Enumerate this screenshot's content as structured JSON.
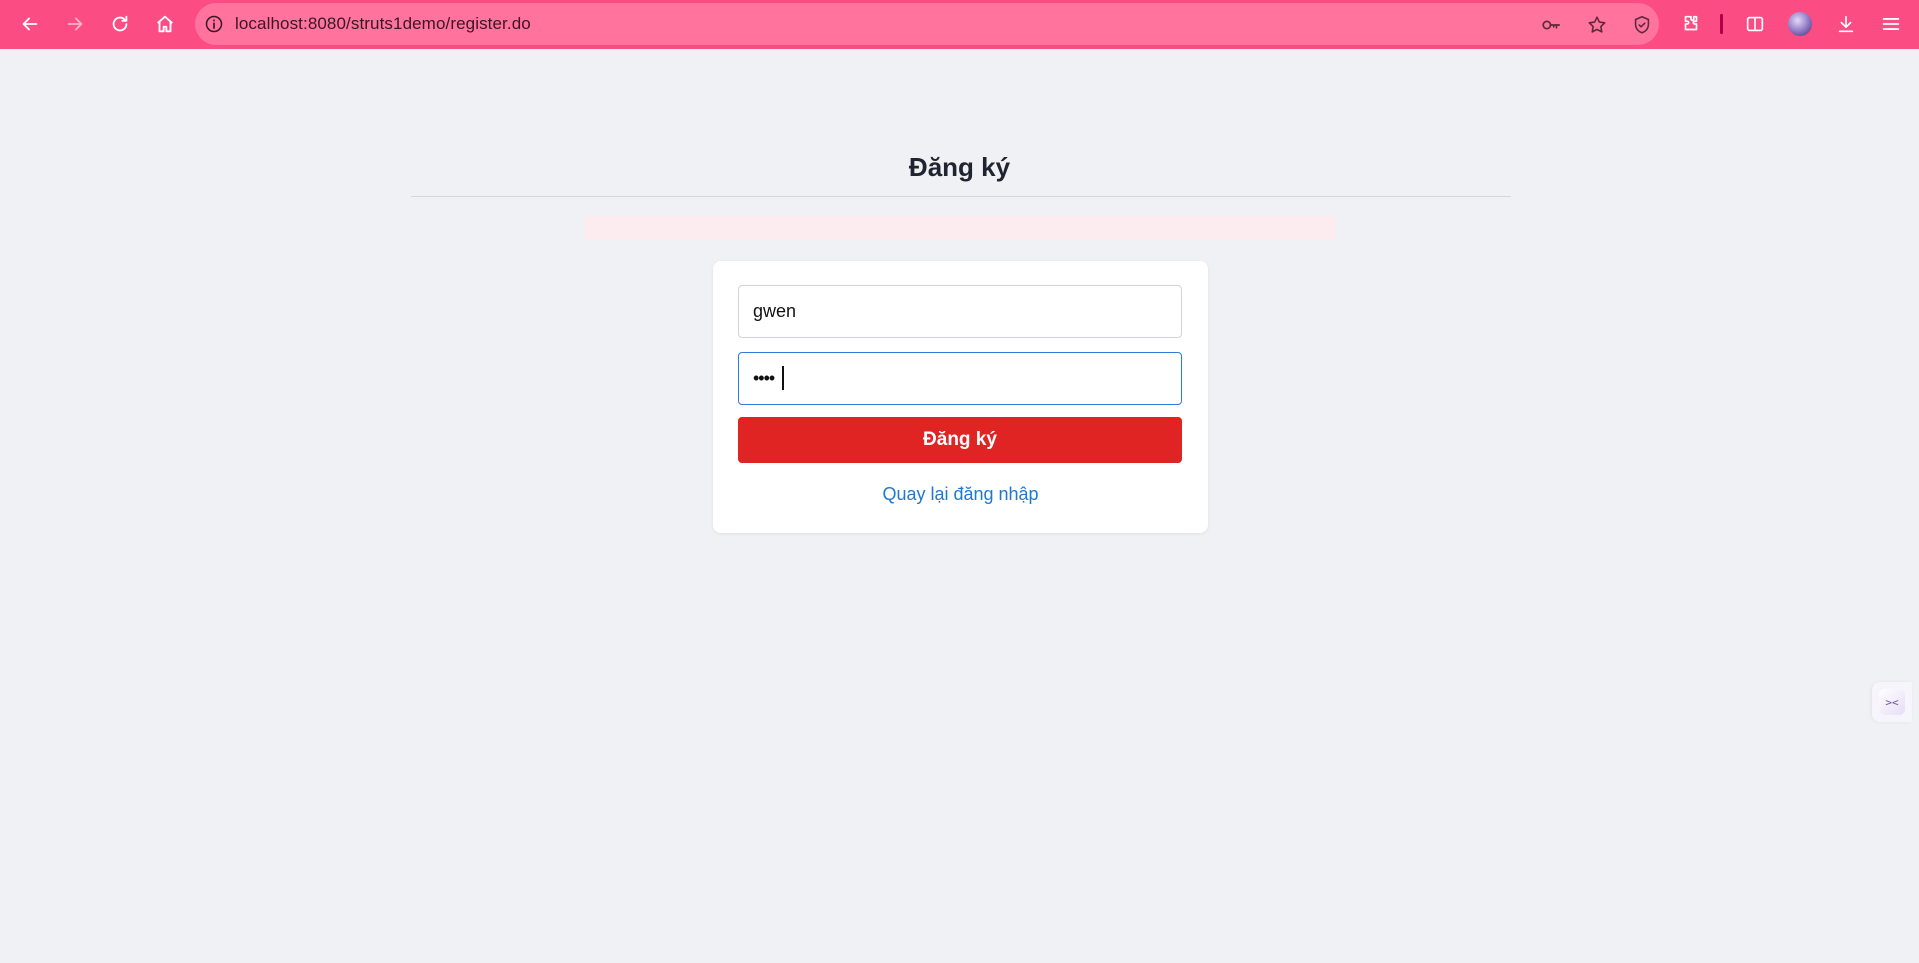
{
  "browser": {
    "url": "localhost:8080/struts1demo/register.do",
    "colors": {
      "toolbar": "#fb4d83",
      "omnibox": "#ff739c"
    },
    "icons": [
      "back-icon",
      "forward-icon",
      "reload-icon",
      "home-icon",
      "site-info-icon",
      "password-key-icon",
      "bookmark-star-icon",
      "shield-extension-icon",
      "extensions-puzzle-icon",
      "split-view-icon",
      "profile-avatar",
      "download-icon",
      "menu-icon"
    ]
  },
  "page": {
    "title": "Đăng ký",
    "error_message": "",
    "form": {
      "username_value": "gwen",
      "password_mask": "••••",
      "submit_label": "Đăng ký",
      "back_link_label": "Quay lại đăng nhập"
    },
    "colors": {
      "background": "#f0f1f5",
      "submit_button": "#e02424",
      "link": "#1f78d1",
      "error_box": "#fdecef"
    },
    "side_widget_icon": "><"
  }
}
